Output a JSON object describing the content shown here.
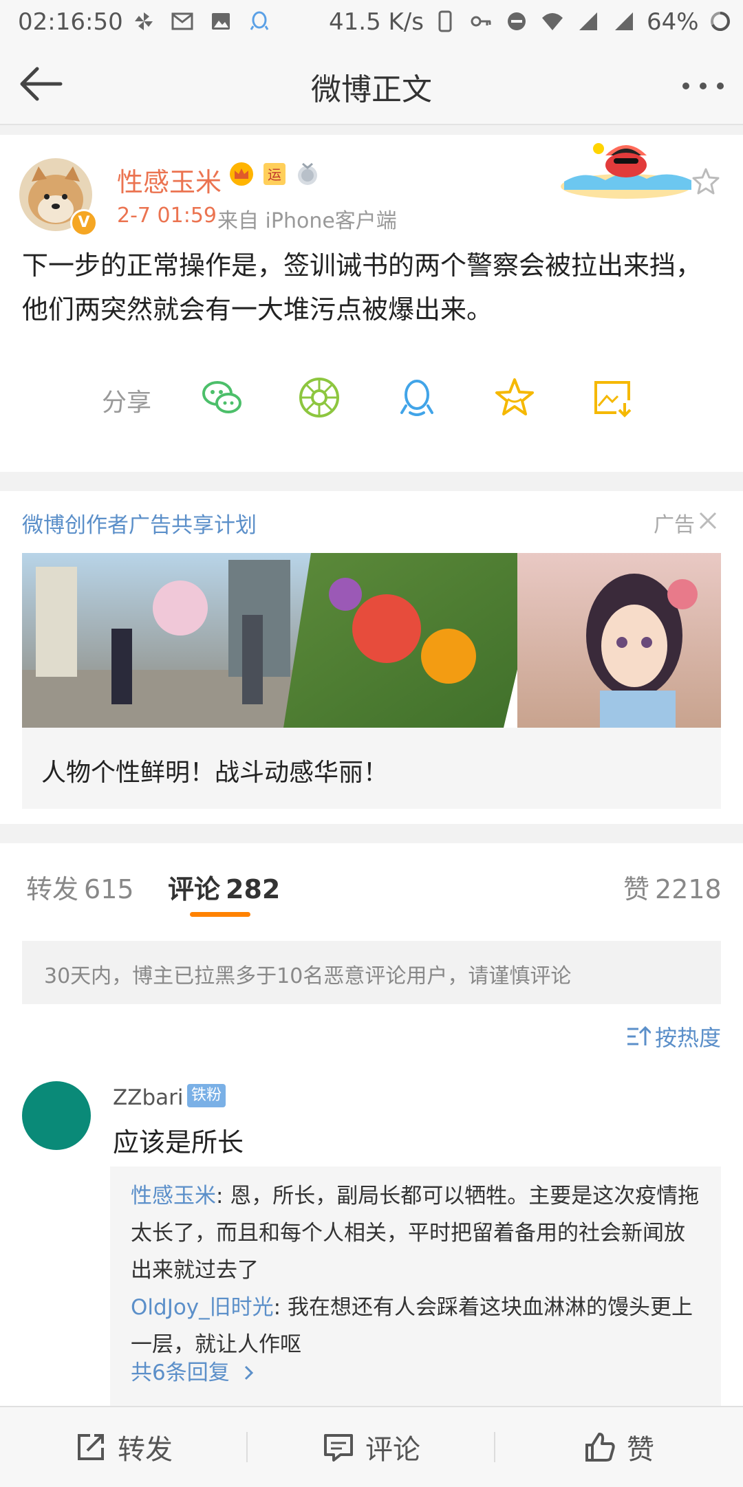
{
  "status_bar": {
    "time": "02:16:50",
    "speed": "41.5 K/s",
    "battery": "64%",
    "icons": [
      "pinwheel-icon",
      "gmail-icon",
      "image-icon",
      "qq-icon",
      "phone-icon",
      "key-icon",
      "dnd-icon",
      "wifi-icon",
      "signal-icon",
      "signal-icon",
      "battery-ring-icon"
    ]
  },
  "nav": {
    "title": "微博正文"
  },
  "post": {
    "username": "性感玉米",
    "time": "2-7 01:59",
    "source": "来自 iPhone客户端",
    "content": "下一步的正常操作是，签训诫书的两个警察会被拉出来挡，他们两突然就会有一大堆污点被爆出来。",
    "share_label": "分享",
    "share_targets": [
      "wechat-icon",
      "moments-icon",
      "qq-icon",
      "weibo-favorite-icon",
      "save-image-icon"
    ]
  },
  "ad": {
    "title": "微博创作者广告共享计划",
    "tag": "广告",
    "caption": "人物个性鲜明！战斗动感华丽！"
  },
  "tabs": {
    "repost_label": "转发",
    "repost_count": "615",
    "comment_label": "评论",
    "comment_count": "282",
    "like_label": "赞",
    "like_count": "2218"
  },
  "comments": {
    "notice": "30天内，博主已拉黑多于10名恶意评论用户，请谨慎评论",
    "sort_label": "按热度",
    "items": [
      {
        "user": "ZZbari",
        "fan_badge": "铁粉",
        "text": "应该是所长",
        "replies": [
          {
            "user": "性感玉米",
            "text": ": 恩，所长，副局长都可以牺牲。主要是这次疫情拖太长了，而且和每个人相关，平时把留着备用的社会新闻放出来就过去了"
          },
          {
            "user": "OldJoy_旧时光",
            "text": ": 我在想还有人会踩着这块血淋淋的馒头更上一层，就让人作呕"
          }
        ],
        "more_replies": "共6条回复"
      }
    ]
  },
  "bottom_bar": {
    "repost": "转发",
    "comment": "评论",
    "like": "赞"
  },
  "colors": {
    "accent_orange": "#ff8200",
    "username_orange": "#eb7350",
    "link_blue": "#5b8fc9"
  }
}
